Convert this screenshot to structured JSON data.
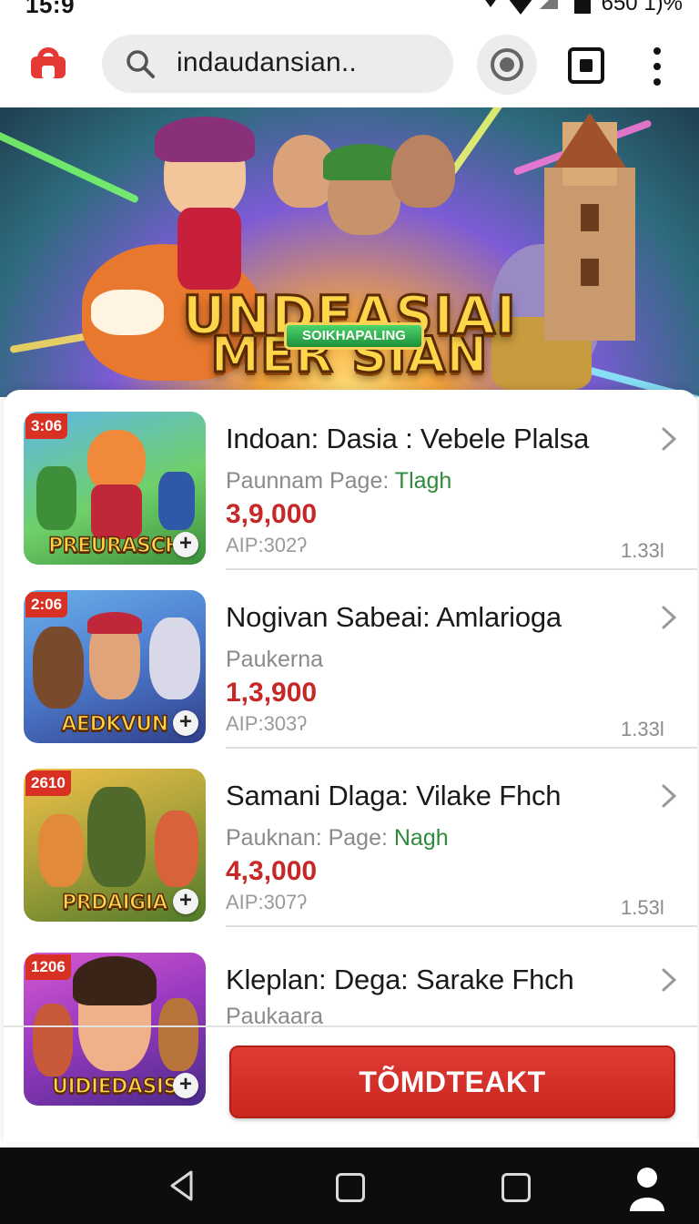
{
  "status": {
    "time": "15:9",
    "battery": "650 1)%"
  },
  "browser": {
    "search_text": "indaudansian.."
  },
  "hero": {
    "title_line1": "MER SIAN",
    "title_line2": "UNDEASIAI",
    "badge": "SOIKHAPALING"
  },
  "items": [
    {
      "time": "3:06",
      "caption": "PREURASCH",
      "title": "Indoan: Dasia : Vebele Plalsa",
      "sub_gray": "Paunnam Page: ",
      "sub_green": "Tlagh",
      "price": "3,9,000",
      "aip": "AIP:302ʔ",
      "count": "1.33l"
    },
    {
      "time": "2:06",
      "caption": "AEDKVUN",
      "title": "Nogivan Sabeai: Amlarioga",
      "sub_gray": "Paukerna",
      "sub_green": "",
      "price": "1,3,900",
      "aip": "AIP:303ʔ",
      "count": "1.33l"
    },
    {
      "time": "2610",
      "caption": "PRDAIGIA",
      "title": "Samani Dlaga: Vilake Fhch",
      "sub_gray": "Pauknan: Page: ",
      "sub_green": "Nagh",
      "price": "4,3,000",
      "aip": "AIP:307ʔ",
      "count": "1.53l"
    },
    {
      "time": "1206",
      "caption": "UIDIEDASIS",
      "title": "Kleplan: Dega: Sarake Fhch",
      "sub_gray": "Paukaara",
      "sub_green": "",
      "price": "",
      "aip": "",
      "count": ""
    }
  ],
  "cta": {
    "label": "TÕMDTEAKT"
  },
  "colors": {
    "accent_red": "#d93024",
    "price_red": "#c62828",
    "green": "#2e8b3a"
  },
  "icons": [
    "home-icon",
    "search-icon",
    "record-icon",
    "stop-icon",
    "menu-icon",
    "chevron-right-icon",
    "plus-icon",
    "back-icon",
    "home-square-icon",
    "recent-apps-icon",
    "person-icon"
  ]
}
